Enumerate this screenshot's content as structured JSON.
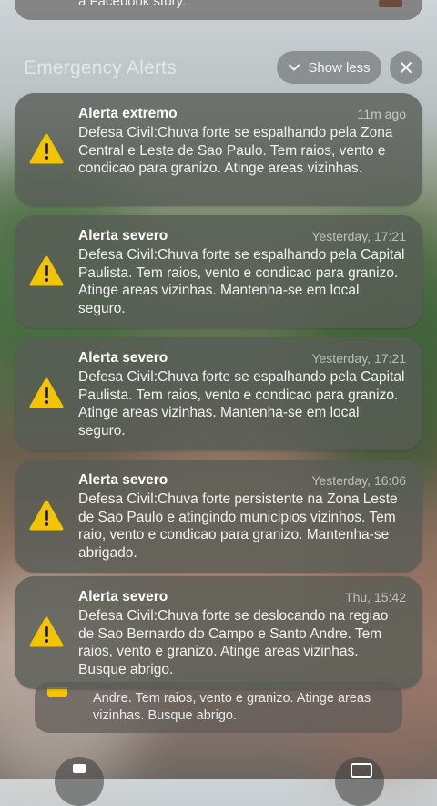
{
  "colors": {
    "warning_yellow": "#F5C400",
    "card_bg": "#585C56",
    "text": "#FFFFFF"
  },
  "top_notification": {
    "visible_text": "a Facebook story."
  },
  "header": {
    "title": "Emergency Alerts",
    "show_less_label": "Show less",
    "show_less_icon": "chevron-down-icon",
    "close_icon": "close-icon"
  },
  "alerts": [
    {
      "title": "Alerta extremo",
      "time": "11m ago",
      "icon": "warning-triangle-icon",
      "body": "Defesa Civil:Chuva forte se espalhando pela Zona Central e Leste de Sao Paulo. Tem raios, vento e condicao para granizo. Atinge areas vizinhas."
    },
    {
      "title": "Alerta severo",
      "time": "Yesterday, 17:21",
      "icon": "warning-triangle-icon",
      "body": "Defesa Civil:Chuva forte se espalhando pela Capital Paulista. Tem raios, vento e condicao para granizo. Atinge areas vizinhas. Mantenha-se em local seguro."
    },
    {
      "title": "Alerta severo",
      "time": "Yesterday, 17:21",
      "icon": "warning-triangle-icon",
      "body": "Defesa Civil:Chuva forte se espalhando pela Capital Paulista. Tem raios, vento e condicao para granizo. Atinge areas vizinhas. Mantenha-se em local seguro."
    },
    {
      "title": "Alerta severo",
      "time": "Yesterday, 16:06",
      "icon": "warning-triangle-icon",
      "body": "Defesa Civil:Chuva forte persistente na Zona Leste de Sao Paulo e atingindo municipios vizinhos. Tem raio, vento e condicao para granizo. Mantenha-se abrigado."
    },
    {
      "title": "Alerta severo",
      "time": "Thu, 15:42",
      "icon": "warning-triangle-icon",
      "body": "Defesa Civil:Chuva forte se deslocando na regiao de Sao Bernardo do Campo e Santo Andre. Tem raios, vento e granizo. Atinge areas vizinhas. Busque abrigo."
    }
  ],
  "stacked_notification": {
    "body": "Andre. Tem raios, vento e granizo. Atinge areas vizinhas. Busque abrigo."
  },
  "lockscreen": {
    "flashlight_icon": "flashlight-icon",
    "camera_icon": "camera-icon"
  }
}
